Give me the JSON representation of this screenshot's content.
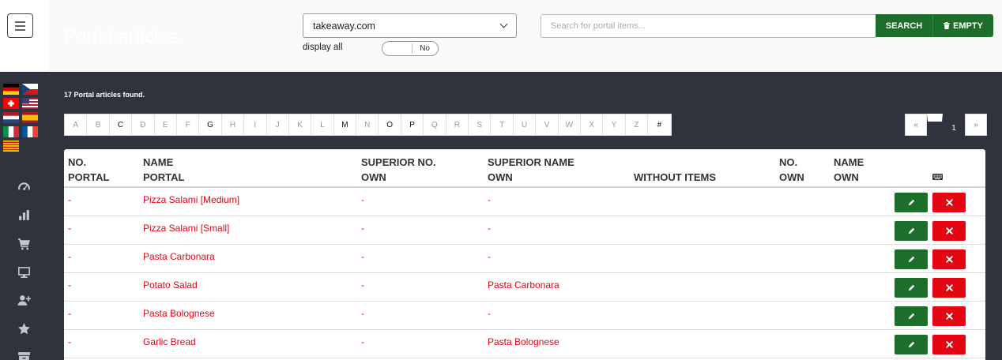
{
  "header": {
    "title": "Portal articles",
    "portal_select": {
      "value": "takeaway.com"
    },
    "display_all": {
      "label": "display all",
      "toggle_value": "No"
    },
    "search": {
      "placeholder": "Search for portal items...",
      "search_label": "SEARCH",
      "empty_label": "EMPTY"
    }
  },
  "sidebar": {
    "flags": [
      "de",
      "cz",
      "ch",
      "us",
      "nl",
      "es",
      "it",
      "fr",
      "catalonia"
    ],
    "icons": [
      "dashboard-icon",
      "bar-chart-icon",
      "cart-icon",
      "monitor-icon",
      "add-user-icon",
      "star-icon",
      "archive-icon"
    ]
  },
  "content": {
    "found_text": "17 Portal articles found.",
    "alphabet": [
      {
        "l": "A",
        "a": false
      },
      {
        "l": "B",
        "a": false
      },
      {
        "l": "C",
        "a": true
      },
      {
        "l": "D",
        "a": false
      },
      {
        "l": "E",
        "a": false
      },
      {
        "l": "F",
        "a": false
      },
      {
        "l": "G",
        "a": true
      },
      {
        "l": "H",
        "a": false
      },
      {
        "l": "I",
        "a": false
      },
      {
        "l": "J",
        "a": false
      },
      {
        "l": "K",
        "a": false
      },
      {
        "l": "L",
        "a": false
      },
      {
        "l": "M",
        "a": true
      },
      {
        "l": "N",
        "a": false
      },
      {
        "l": "O",
        "a": true
      },
      {
        "l": "P",
        "a": true
      },
      {
        "l": "Q",
        "a": false
      },
      {
        "l": "R",
        "a": false
      },
      {
        "l": "S",
        "a": false
      },
      {
        "l": "T",
        "a": false
      },
      {
        "l": "U",
        "a": false
      },
      {
        "l": "V",
        "a": false
      },
      {
        "l": "W",
        "a": false
      },
      {
        "l": "X",
        "a": false
      },
      {
        "l": "Y",
        "a": false
      },
      {
        "l": "Z",
        "a": false
      },
      {
        "l": "#",
        "a": true
      }
    ],
    "pagination": {
      "prev": "«",
      "current": "1",
      "next": "»"
    }
  },
  "table": {
    "columns": {
      "no_portal": [
        "NO.",
        "PORTAL"
      ],
      "name_portal": [
        "NAME",
        "PORTAL"
      ],
      "superior_no_own": [
        "SUPERIOR NO.",
        "OWN"
      ],
      "superior_name_own": [
        "SUPERIOR NAME",
        "OWN"
      ],
      "without_items": [
        "",
        "WITHOUT ITEMS"
      ],
      "no_own": [
        "NO.",
        "OWN"
      ],
      "name_own": [
        "NAME",
        "OWN"
      ]
    },
    "rows": [
      {
        "no_portal": "-",
        "name_portal": "Pizza Salami [Medium]",
        "superior_no_own": "-",
        "superior_name_own": "-"
      },
      {
        "no_portal": "-",
        "name_portal": "Pizza Salami [Small]",
        "superior_no_own": "-",
        "superior_name_own": "-"
      },
      {
        "no_portal": "-",
        "name_portal": "Pasta Carbonara",
        "superior_no_own": "-",
        "superior_name_own": "-"
      },
      {
        "no_portal": "-",
        "name_portal": "Potato Salad",
        "superior_no_own": "-",
        "superior_name_own": "Pasta Carbonara"
      },
      {
        "no_portal": "-",
        "name_portal": "Pasta Bolognese",
        "superior_no_own": "-",
        "superior_name_own": "-"
      },
      {
        "no_portal": "-",
        "name_portal": "Garlic Bread",
        "superior_no_own": "-",
        "superior_name_own": "Pasta Bolognese"
      }
    ]
  },
  "colors": {
    "primary_green": "#1e6e2b",
    "danger_red": "#e30613",
    "sidebar_bg": "#2e333d"
  }
}
